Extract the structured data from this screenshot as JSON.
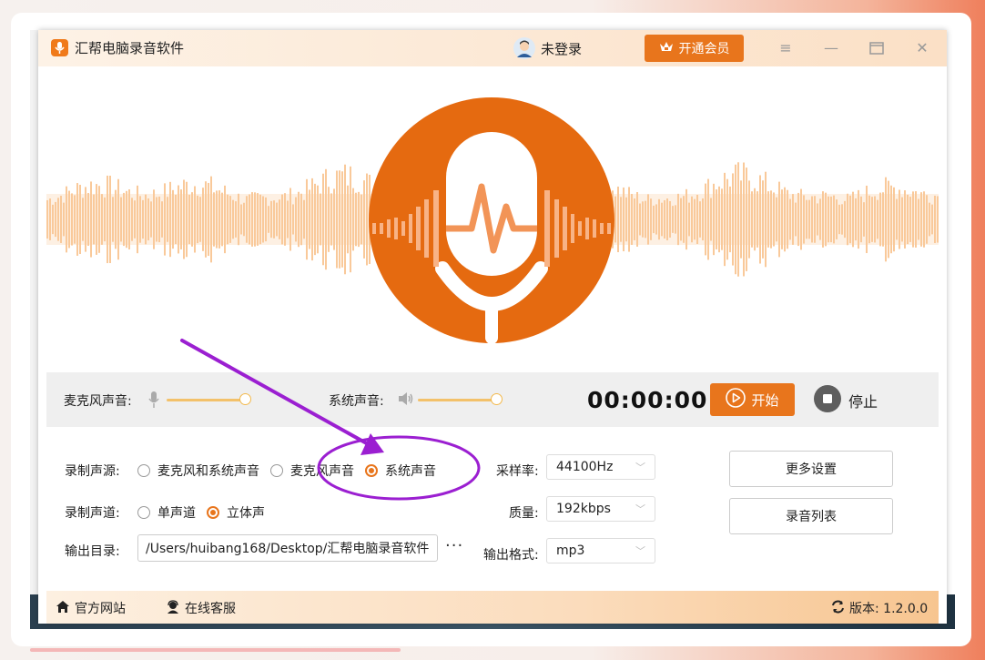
{
  "app": {
    "title": "汇帮电脑录音软件",
    "login_status": "未登录",
    "vip_button": "开通会员",
    "menu_icon": "menu-icon",
    "minimize_icon": "minimize-icon",
    "maximize_icon": "maximize-icon",
    "close_icon": "close-icon"
  },
  "controls": {
    "mic_label": "麦克风声音:",
    "mic_level": 0.93,
    "system_label": "系统声音:",
    "system_level": 0.93,
    "timer": "00:00:00",
    "start_label": "开始",
    "stop_label": "停止"
  },
  "settings": {
    "source_label": "录制声源:",
    "source_options": [
      "麦克风和系统声音",
      "麦克风声音",
      "系统声音"
    ],
    "source_selected": "系统声音",
    "channel_label": "录制声道:",
    "channel_options": [
      "单声道",
      "立体声"
    ],
    "channel_selected": "立体声",
    "output_dir_label": "输出目录:",
    "output_dir_value": "/Users/huibang168/Desktop/汇帮电脑录音软件",
    "more_label": "···",
    "samplerate_label": "采样率:",
    "samplerate_value": "44100Hz",
    "quality_label": "质量:",
    "quality_value": "192kbps",
    "format_label": "输出格式:",
    "format_value": "mp3",
    "more_settings_button": "更多设置",
    "record_list_button": "录音列表"
  },
  "footer": {
    "website": "官方网站",
    "support": "在线客服",
    "version_label": "版本: 1.2.0.0"
  },
  "colors": {
    "accent": "#e8751c",
    "wave": "#f9c99a",
    "annotation": "#9b1fd1"
  }
}
